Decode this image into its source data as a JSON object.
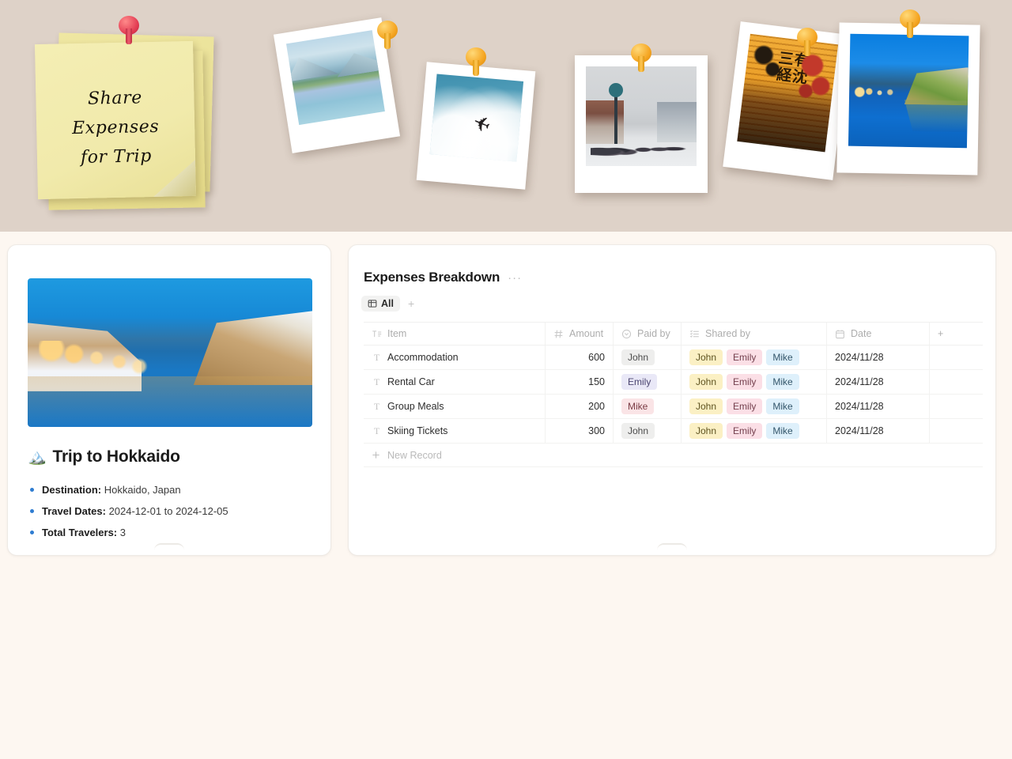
{
  "hero": {
    "sticky_note": {
      "line1": "Share",
      "line2": "Expenses",
      "line3": "for Trip"
    },
    "pins": [
      {
        "name": "red-pushpin",
        "color": "#e23b52"
      },
      {
        "name": "yellow-pushpin",
        "color": "#f5a623"
      }
    ],
    "photos": [
      {
        "name": "fjord-photo",
        "alt": "Fjord with mountains and camper van"
      },
      {
        "name": "airplane-sky-photo",
        "alt": "Airplane flying in cloudy sky"
      },
      {
        "name": "snowy-street-photo",
        "alt": "Snowy Japanese street scene"
      },
      {
        "name": "lantern-photo",
        "alt": "Japanese lanterns with kanji"
      },
      {
        "name": "otaru-canal-photo",
        "alt": "Otaru canal at dusk"
      }
    ],
    "lantern_text": "三有 経沈"
  },
  "trip_card": {
    "image_name": "otaru-canal-winter-image",
    "emoji": "🏔️",
    "title": "Trip to Hokkaido",
    "facts": [
      {
        "label": "Destination:",
        "value": "Hokkaido, Japan"
      },
      {
        "label": "Travel Dates:",
        "value": "2024-12-01 to 2024-12-05"
      },
      {
        "label": "Total Travelers:",
        "value": "3"
      }
    ]
  },
  "database": {
    "title": "Expenses Breakdown",
    "more_menu": "···",
    "view_tab": {
      "label": "All",
      "icon": "table-view-icon"
    },
    "add_view": "+",
    "add_column": "+",
    "new_record_label": "New Record",
    "columns": [
      {
        "key": "item",
        "label": "Item",
        "icon": "text-field-icon"
      },
      {
        "key": "amount",
        "label": "Amount",
        "icon": "number-field-icon"
      },
      {
        "key": "paid",
        "label": "Paid by",
        "icon": "single-select-icon"
      },
      {
        "key": "shared",
        "label": "Shared by",
        "icon": "multi-select-icon"
      },
      {
        "key": "date",
        "label": "Date",
        "icon": "date-field-icon"
      }
    ],
    "rows": [
      {
        "item": "Accommodation",
        "amount": "600",
        "paid_by": "John",
        "shared_by": [
          "John",
          "Emily",
          "Mike"
        ],
        "date": "2024/11/28"
      },
      {
        "item": "Rental Car",
        "amount": "150",
        "paid_by": "Emily",
        "shared_by": [
          "John",
          "Emily",
          "Mike"
        ],
        "date": "2024/11/28"
      },
      {
        "item": "Group Meals",
        "amount": "200",
        "paid_by": "Mike",
        "shared_by": [
          "John",
          "Emily",
          "Mike"
        ],
        "date": "2024/11/28"
      },
      {
        "item": "Skiing Tickets",
        "amount": "300",
        "paid_by": "John",
        "shared_by": [
          "John",
          "Emily",
          "Mike"
        ],
        "date": "2024/11/28"
      }
    ],
    "chip_colors": {
      "paid_by": {
        "John": {
          "bg": "#eeeeed",
          "fg": "#4c4c4c"
        },
        "Emily": {
          "bg": "#e9e8f7",
          "fg": "#4a4470"
        },
        "Mike": {
          "bg": "#fae4e6",
          "fg": "#7a3b44"
        }
      },
      "shared_by": {
        "John": {
          "bg": "#fbf0c4",
          "fg": "#5e5320"
        },
        "Emily": {
          "bg": "#fbdfe6",
          "fg": "#74404e"
        },
        "Mike": {
          "bg": "#def0fb",
          "fg": "#33566b"
        }
      }
    }
  },
  "colors": {
    "page_bg": "#fdf7f1",
    "hero_bg": "#ded2c8",
    "card_bg": "#ffffff",
    "accent_blue": "#2f7dd1"
  }
}
